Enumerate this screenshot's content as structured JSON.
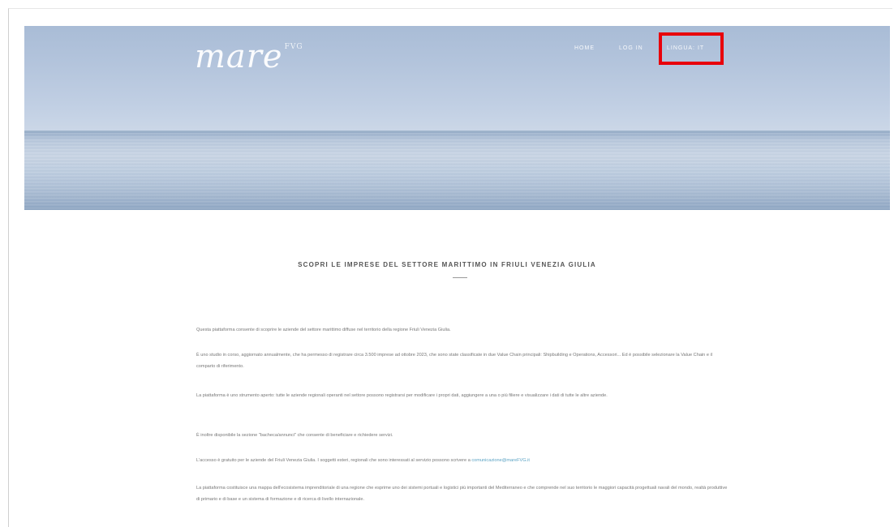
{
  "brand": {
    "logo_text": "mare",
    "logo_sup": "FVG"
  },
  "nav": {
    "home": "HOME",
    "login": "LOG IN",
    "language": "LINGUA: IT"
  },
  "main": {
    "heading": "SCOPRI LE IMPRESE DEL SETTORE MARITTIMO IN FRIULI VENEZIA GIULIA",
    "paragraphs": {
      "p1": "Questa piattaforma consente di scoprire le aziende del settore marittimo diffuse nel territorio della regione Friuli Venezia Giulia.",
      "p2": "È uno studio in corso, aggiornato annualmente, che ha permesso di registrare circa 3.500 imprese ad ottobre 2023, che sono state classificate in due Value Chain principali: Shipbuilding e Operations, Accessori... Ed è possibile selezionare la Value Chain e il comparto di riferimento.",
      "p3": "La piattaforma è uno strumento aperto: tutte le aziende regionali operanti nel settore possono registrarsi per modificare i propri dati, aggiungere a una o più filiere e visualizzare i dati di tutte le altre aziende.",
      "p4": "È inoltre disponibile la sezione \"bacheca/annunci\" che consente di beneficiare e richiedere servizi.",
      "p5_text": "L'accesso è gratuito per le aziende del Friuli Venezia Giulia. I soggetti esteri, regionali che sono interessati al servizio possono scrivere a",
      "p5_link": "comunicazione@mareFVG.it",
      "p6": "La piattaforma costituisce una mappa dell'ecosistema imprenditoriale di una regione che esprime uno dei sistemi portuali e logistici più importanti del Mediterraneo e che comprende nel suo territorio le maggiori capacità progettuali navali del mondo, realtà produttive di primario e di base e un sistema di formazione e di ricerca di livello internazionale."
    }
  }
}
